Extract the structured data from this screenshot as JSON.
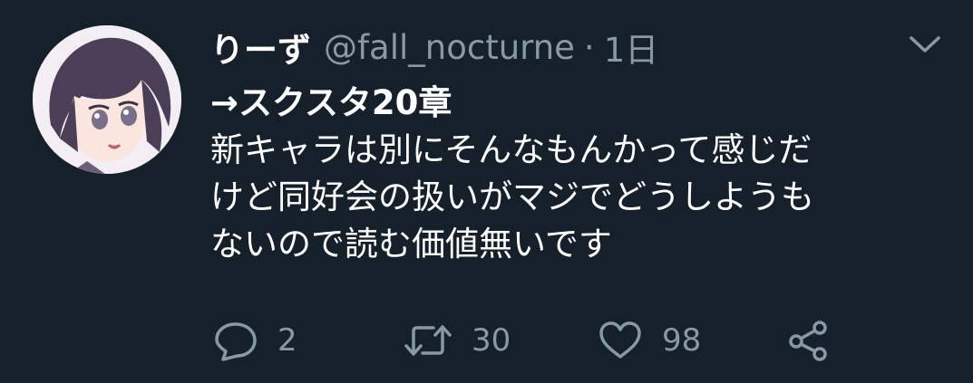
{
  "user": {
    "display_name": "りーず",
    "handle": "@fall_nocturne",
    "separator": "·",
    "time": "1日"
  },
  "tweet": {
    "lines": [
      "→スクスタ20章",
      "新キャラは別にそんなもんかって感じだ",
      "けど同好会の扱いがマジでどうしようも",
      "ないので読む価値無いです"
    ]
  },
  "actions": {
    "reply_count": "2",
    "retweet_count": "30",
    "like_count": "98"
  },
  "icons": {
    "reply": "speech-bubble-icon",
    "retweet": "retweet-arrows-icon",
    "like": "heart-icon",
    "share": "share-icon",
    "menu": "chevron-down-icon"
  },
  "colors": {
    "background": "#15202b",
    "text": "#ffffff",
    "muted": "#8899a6"
  }
}
